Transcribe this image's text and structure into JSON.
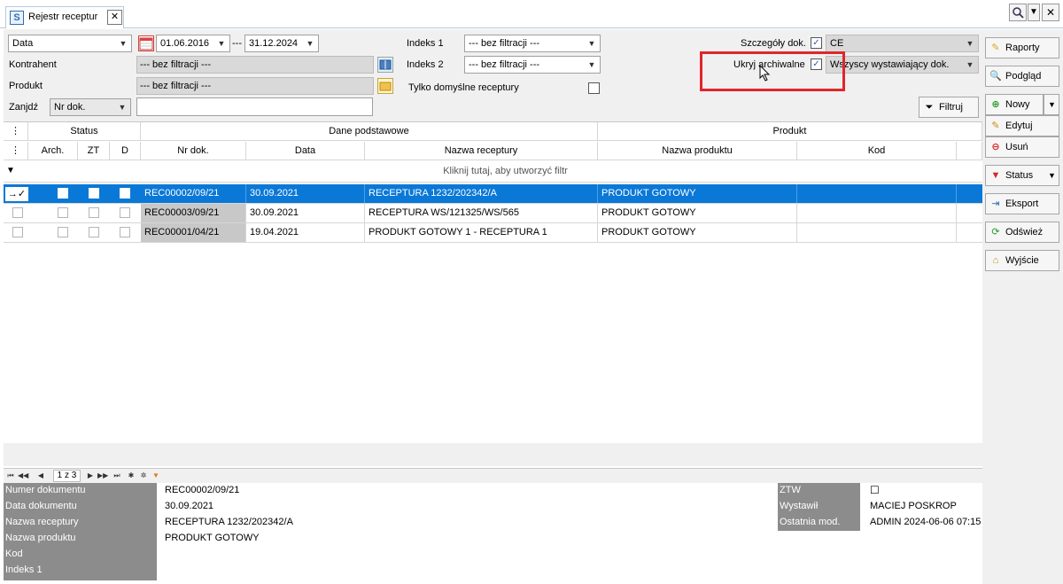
{
  "tab": {
    "icon": "S",
    "title": "Rejestr receptur",
    "close": "✕"
  },
  "window_controls": {
    "search_icon": "search-icon",
    "dropdown": "▼",
    "close": "✕"
  },
  "filters": {
    "date_type": "Data",
    "date_from": "01.06.2016",
    "date_separator": "---",
    "date_to": "31.12.2024",
    "kontrahent_label": "Kontrahent",
    "kontrahent_value": "--- bez filtracji ---",
    "produkt_label": "Produkt",
    "produkt_value": "--- bez filtracji ---",
    "zanjdz_label": "Zanjdź",
    "zanjdz_mode": "Nr dok.",
    "zanjdz_value": "",
    "indeks1_label": "Indeks 1",
    "indeks1_value": "--- bez filtracji ---",
    "indeks2_label": "Indeks 2",
    "indeks2_value": "--- bez filtracji ---",
    "tylko_label": "Tylko domyślne receptury",
    "szczegoly_label": "Szczegóły dok.",
    "szczegoly_value": "CE",
    "ukryj_label": "Ukryj archiwalne",
    "wystawiajacy_value": "Wszyscy wystawiający dok.",
    "filtruj_label": "Filtruj"
  },
  "grid": {
    "group_headers": {
      "status": "Status",
      "dane": "Dane podstawowe",
      "produkt": "Produkt"
    },
    "columns": {
      "arch": "Arch.",
      "zt": "ZT",
      "d": "D",
      "nr": "Nr dok.",
      "data": "Data",
      "nazwa_receptury": "Nazwa receptury",
      "nazwa_produktu": "Nazwa produktu",
      "kod": "Kod"
    },
    "filter_hint": "Kliknij tutaj, aby utworzyć filtr",
    "rows": [
      {
        "nr": "REC00002/09/21",
        "data": "30.09.2021",
        "nazwa_receptury": "RECEPTURA 1232/202342/A",
        "nazwa_produktu": "PRODUKT GOTOWY",
        "kod": ""
      },
      {
        "nr": "REC00003/09/21",
        "data": "30.09.2021",
        "nazwa_receptury": "RECEPTURA WS/121325/WS/565",
        "nazwa_produktu": "PRODUKT GOTOWY",
        "kod": ""
      },
      {
        "nr": "REC00001/04/21",
        "data": "19.04.2021",
        "nazwa_receptury": "PRODUKT GOTOWY 1 - RECEPTURA 1",
        "nazwa_produktu": "PRODUKT GOTOWY",
        "kod": ""
      }
    ]
  },
  "pager": {
    "page": "1 z 3"
  },
  "details": {
    "labels": [
      "Numer dokumentu",
      "Data dokumentu",
      "Nazwa receptury",
      "Nazwa produktu",
      "Kod",
      "Indeks 1"
    ],
    "values": [
      "REC00002/09/21",
      "30.09.2021",
      "RECEPTURA 1232/202342/A",
      "PRODUKT GOTOWY",
      "",
      ""
    ],
    "right_labels": [
      "ZTW",
      "Wystawił",
      "Ostatnia mod."
    ],
    "right_values": [
      "☐",
      "MACIEJ POSKROP",
      "ADMIN 2024-06-06 07:15"
    ]
  },
  "toolbar": {
    "raporty": "Raporty",
    "podglad": "Podgląd",
    "nowy": "Nowy",
    "edytuj": "Edytuj",
    "usun": "Usuń",
    "status": "Status",
    "eksport": "Eksport",
    "odswiez": "Odśwież",
    "wyjscie": "Wyjście"
  },
  "colors": {
    "selection": "#0a78d7",
    "highlight_box": "#e0262b",
    "label_panel": "#8c8c8c"
  }
}
